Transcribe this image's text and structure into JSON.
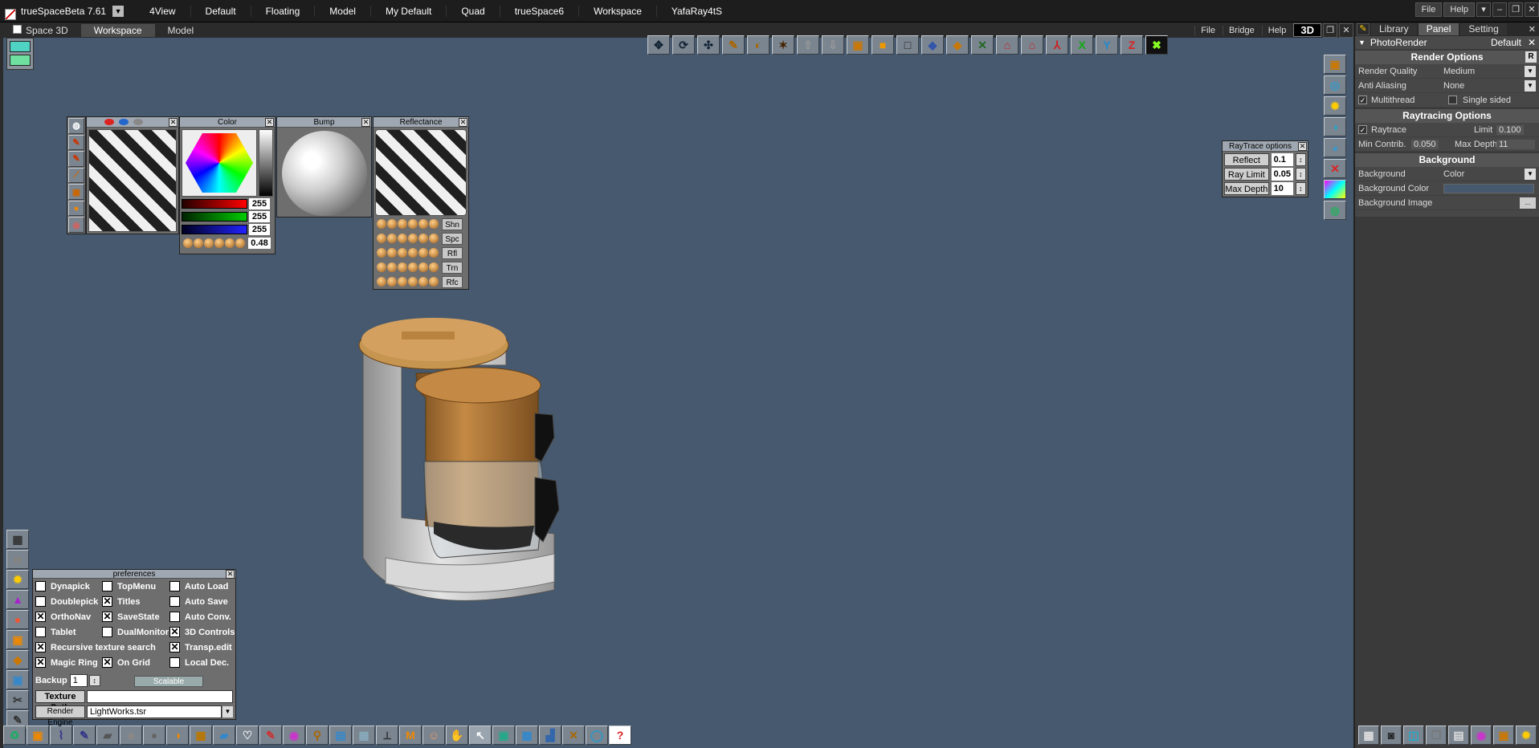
{
  "titlebar": {
    "app_name": "trueSpaceBeta 7.61",
    "menu": [
      "4View",
      "Default",
      "Floating",
      "Model",
      "My Default",
      "Quad",
      "trueSpace6",
      "Workspace",
      "YafaRay4tS"
    ],
    "file": "File",
    "help": "Help"
  },
  "subbar": {
    "space": "Space 3D",
    "tabs": [
      "Workspace",
      "Model"
    ],
    "file": "File",
    "bridge": "Bridge",
    "help": "Help",
    "mode_3d": "3D"
  },
  "material_panels": {
    "color_title": "Color",
    "bump_title": "Bump",
    "reflectance_title": "Reflectance",
    "rgb": [
      "255",
      "255",
      "255"
    ],
    "orb_value": "0.48",
    "reflect_tags": [
      "Shn",
      "Spc",
      "Rfl",
      "Trn",
      "Rfc"
    ]
  },
  "raytrace_options": {
    "title": "RayTrace options",
    "rows": [
      {
        "label": "Reflect",
        "value": "0.1"
      },
      {
        "label": "Ray Limit",
        "value": "0.05"
      },
      {
        "label": "Max Depth",
        "value": "10"
      }
    ]
  },
  "right_panel": {
    "tabs": [
      "Library",
      "Panel",
      "Setting"
    ],
    "header": "PhotoRender",
    "header_right": "Default",
    "render_options_title": "Render Options",
    "render_quality_label": "Render Quality",
    "render_quality_value": "Medium",
    "anti_aliasing_label": "Anti Aliasing",
    "anti_aliasing_value": "None",
    "multithread_label": "Multithread",
    "single_sided_label": "Single sided",
    "raytracing_title": "Raytracing Options",
    "raytrace_label": "Raytrace",
    "limit_label": "Limit",
    "limit_value": "0.100",
    "min_contrib_label": "Min Contrib.",
    "min_contrib_value": "0.050",
    "max_depth_label": "Max Depth",
    "max_depth_value": "11",
    "background_title": "Background",
    "background_label": "Background",
    "background_value": "Color",
    "background_color_label": "Background Color",
    "background_image_label": "Background Image",
    "background_image_btn": "..."
  },
  "preferences": {
    "title": "preferences",
    "col1": [
      "Dynapick",
      "Doublepick",
      "OrthoNav",
      "Tablet",
      "Recursive texture search",
      "Magic Ring"
    ],
    "col2": [
      "TopMenu",
      "Titles",
      "SaveState",
      "DualMonitor",
      "",
      "On Grid"
    ],
    "col3": [
      "Auto Load",
      "Auto Save",
      "Auto Conv.",
      "3D Controls",
      "Transp.edit",
      "Local Dec."
    ],
    "backup_label": "Backup",
    "backup_value": "1",
    "scalable": "Scalable",
    "texture_path_label": "Texture Path",
    "render_engine_label": "Render Engine",
    "render_engine_value": "LightWorks.tsr"
  },
  "colors": {
    "viewport_bg": "#46596e",
    "bronze": "#b07a3c"
  }
}
